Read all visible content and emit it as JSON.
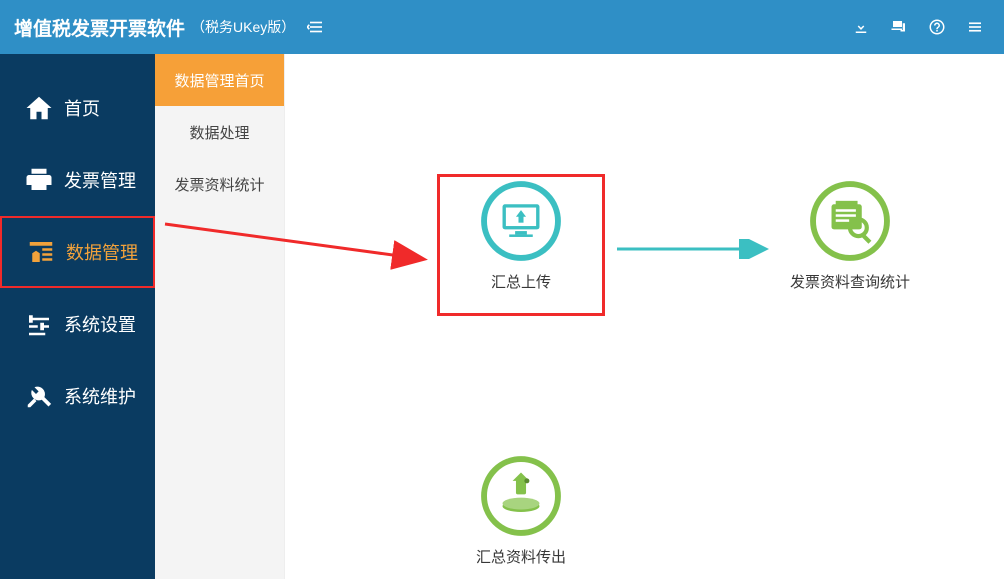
{
  "header": {
    "title_main": "增值税发票开票软件",
    "title_sub": "（税务UKey版）"
  },
  "sidebar": {
    "items": [
      {
        "label": "首页"
      },
      {
        "label": "发票管理"
      },
      {
        "label": "数据管理"
      },
      {
        "label": "系统设置"
      },
      {
        "label": "系统维护"
      }
    ]
  },
  "sub_sidebar": {
    "items": [
      {
        "label": "数据管理首页"
      },
      {
        "label": "数据处理"
      },
      {
        "label": "发票资料统计"
      }
    ]
  },
  "tiles": {
    "upload": {
      "label": "汇总上传"
    },
    "query": {
      "label": "发票资料查询统计"
    },
    "export": {
      "label": "汇总资料传出"
    }
  }
}
